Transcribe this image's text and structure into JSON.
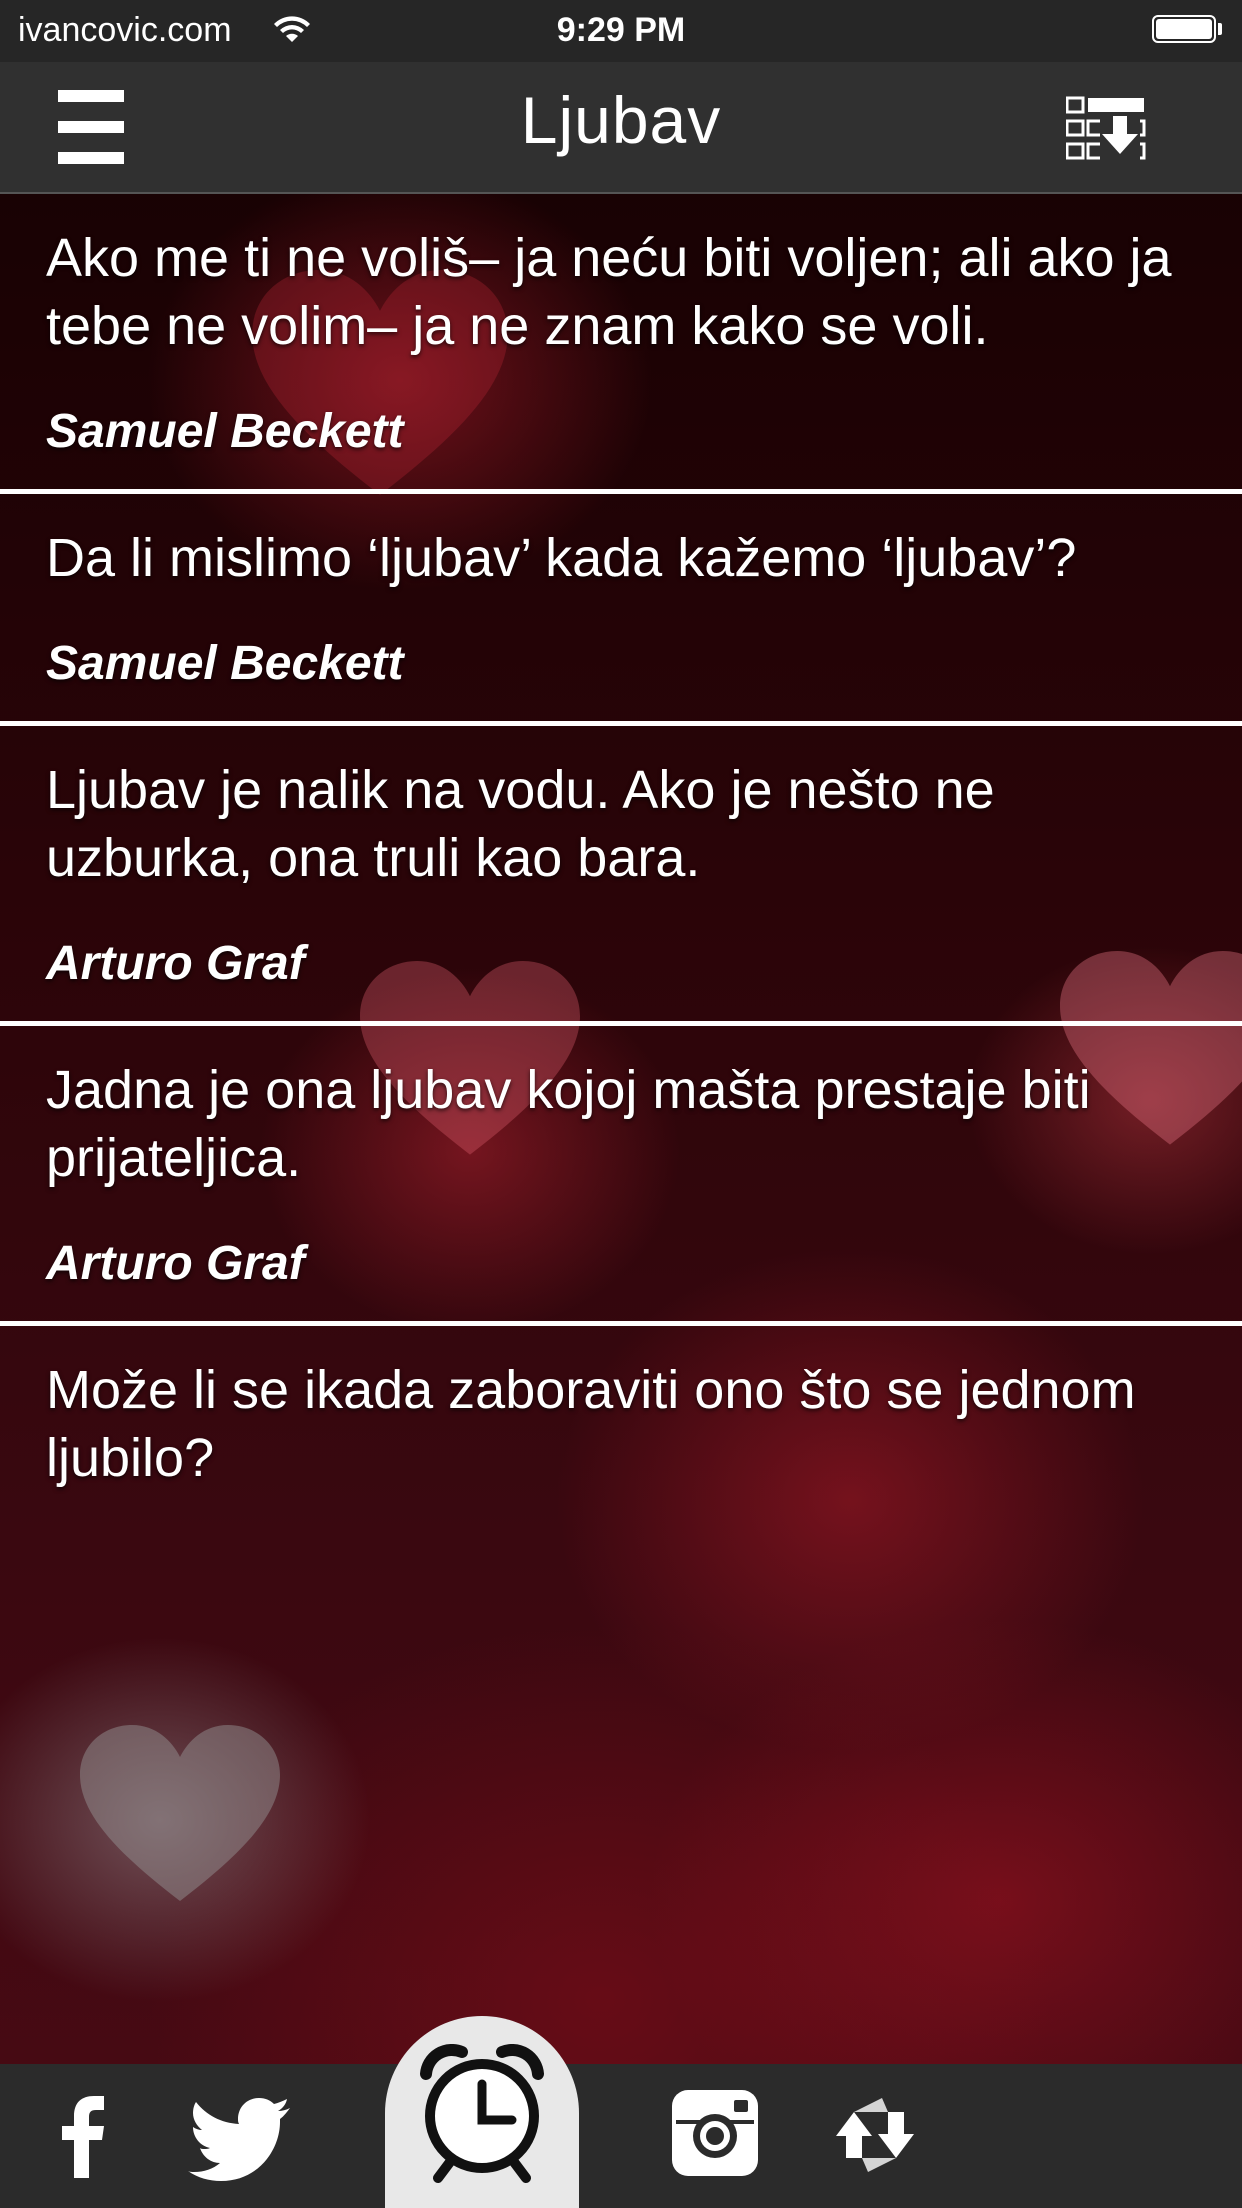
{
  "status_bar": {
    "carrier": "ivancovic.com",
    "time": "9:29 PM"
  },
  "nav": {
    "title": "Ljubav",
    "menu_icon": "hamburger-menu-icon",
    "right_icon": "list-download-icon"
  },
  "quotes": [
    {
      "text": "Ako me ti ne voliš– ja neću biti voljen; ali ako ja tebe ne volim– ja ne znam kako se voli.",
      "author": "Samuel Beckett"
    },
    {
      "text": "Da li mislimo ‘ljubav’ kada kažemo ‘ljubav’?",
      "author": "Samuel Beckett"
    },
    {
      "text": "Ljubav je nalik na vodu. Ako je nešto ne uzburka, ona truli kao bara.",
      "author": "Arturo Graf"
    },
    {
      "text": "Jadna je ona ljubav kojoj mašta prestaje biti prijateljica.",
      "author": "Arturo Graf"
    },
    {
      "text": "Može li se ikada zaboraviti ono što se jednom ljubilo?",
      "author": ""
    }
  ],
  "tab_bar": {
    "items": [
      "facebook-icon",
      "twitter-icon",
      "alarm-clock-icon",
      "instagram-icon",
      "refresh-icon"
    ]
  },
  "colors": {
    "bar_background": "#2b2b2b",
    "nav_background": "#303030",
    "text": "#ffffff",
    "alarm_tab": "#e8e8e8"
  }
}
